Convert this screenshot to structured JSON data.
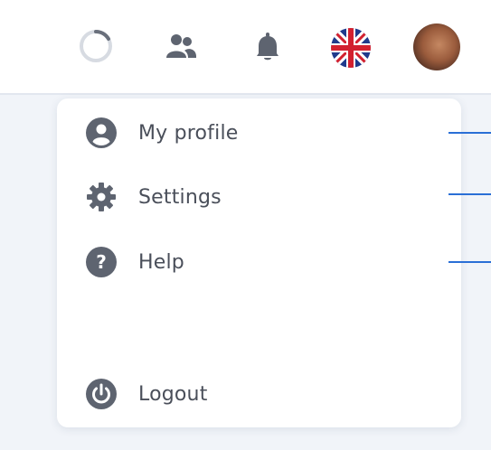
{
  "header": {
    "icons": [
      "loading-spinner-icon",
      "people-icon",
      "bell-icon",
      "uk-flag-icon",
      "user-avatar"
    ]
  },
  "menu": {
    "items": [
      {
        "label": "My profile",
        "icon": "user-circle-icon"
      },
      {
        "label": "Settings",
        "icon": "gear-icon"
      },
      {
        "label": "Help",
        "icon": "question-circle-icon"
      },
      {
        "label": "Logout",
        "icon": "power-icon"
      }
    ]
  },
  "colors": {
    "icon": "#5e6470",
    "text": "#4a4f5a",
    "pointer": "#2a6fd6",
    "page_bg": "#f1f4f9"
  }
}
